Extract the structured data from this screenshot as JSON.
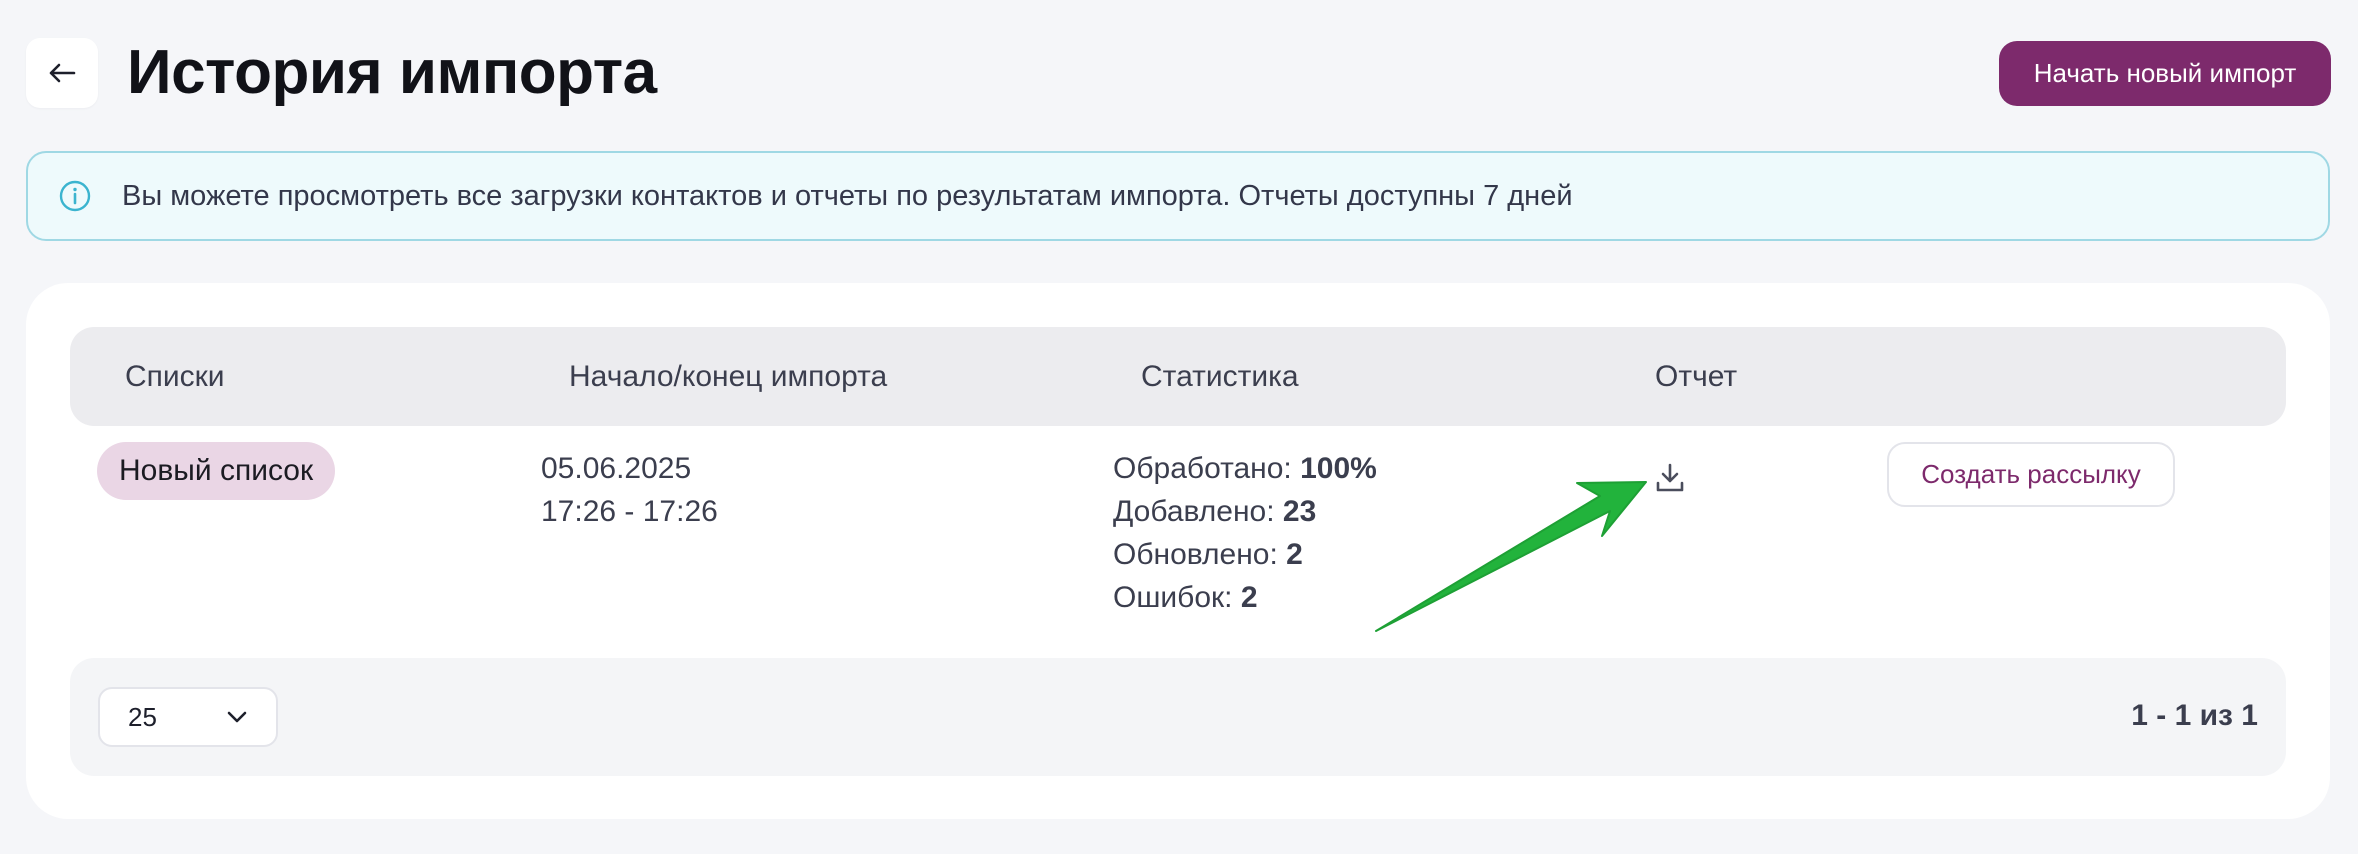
{
  "header": {
    "back_icon": "arrow-left-icon",
    "title": "История импорта",
    "new_import_label": "Начать новый импорт"
  },
  "info_banner": {
    "icon": "info-icon",
    "text": "Вы можете просмотреть все загрузки контактов и отчеты по результатам импорта. Отчеты доступны 7 дней"
  },
  "table": {
    "columns": [
      "Списки",
      "Начало/конец импорта",
      "Статистика",
      "Отчет"
    ],
    "rows": [
      {
        "list_name": "Новый список",
        "date": "05.06.2025",
        "time_range": "17:26 - 17:26",
        "stats": {
          "processed_label": "Обработано:",
          "processed_value": "100%",
          "added_label": "Добавлено:",
          "added_value": "23",
          "updated_label": "Обновлено:",
          "updated_value": "2",
          "errors_label": "Ошибок:",
          "errors_value": "2"
        },
        "report_icon": "download-icon",
        "action_label": "Создать рассылку"
      }
    ]
  },
  "footer": {
    "page_size": "25",
    "page_size_icon": "chevron-down-icon",
    "pagination": "1 - 1 из 1"
  },
  "colors": {
    "brand": "#7d2a6c",
    "banner_bg": "#eefafc",
    "banner_border": "#9fd8e4",
    "badge_bg": "#ead6e5",
    "annotation_arrow": "#22b33c"
  }
}
